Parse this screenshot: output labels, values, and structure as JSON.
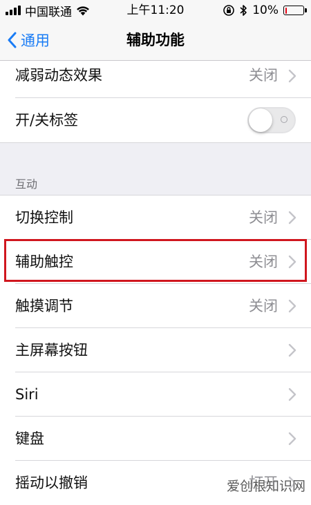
{
  "status_bar": {
    "carrier": "中国联通",
    "time": "上午11:20",
    "battery_percent": "10%",
    "battery_level": 0.1,
    "battery_color": "#e60012"
  },
  "nav": {
    "back_label": "通用",
    "title": "辅助功能"
  },
  "section_top": {
    "rows": [
      {
        "label": "减弱动态效果",
        "value": "关闭"
      },
      {
        "label": "开/关标签",
        "toggle": false
      }
    ]
  },
  "section_interaction": {
    "header": "互动",
    "rows": [
      {
        "label": "切换控制",
        "value": "关闭"
      },
      {
        "label": "辅助触控",
        "value": "关闭",
        "highlighted": true
      },
      {
        "label": "触摸调节",
        "value": "关闭"
      },
      {
        "label": "主屏幕按钮",
        "value": ""
      },
      {
        "label": "Siri",
        "value": ""
      },
      {
        "label": "键盘",
        "value": ""
      },
      {
        "label": "摇动以撤销",
        "value": "打开"
      }
    ]
  },
  "watermark": "爱创根知识网",
  "colors": {
    "accent": "#1a7cf5",
    "highlight": "#d0161e",
    "background": "#efeff4"
  }
}
